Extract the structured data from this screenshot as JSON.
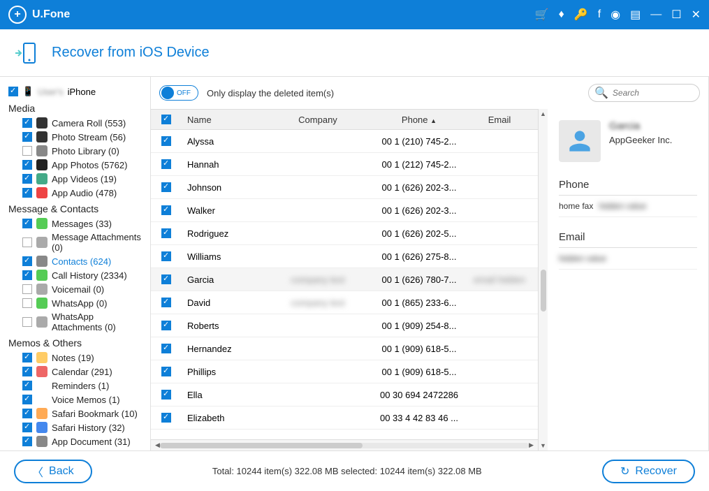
{
  "app_name": "U.Fone",
  "header": {
    "title": "Recover from iOS Device"
  },
  "sidebar": {
    "device": "iPhone",
    "sections": [
      {
        "title": "Media",
        "items": [
          {
            "label": "Camera Roll (553)",
            "checked": true,
            "iconBg": "#333"
          },
          {
            "label": "Photo Stream (56)",
            "checked": true,
            "iconBg": "#333"
          },
          {
            "label": "Photo Library (0)",
            "checked": false,
            "iconBg": "#888"
          },
          {
            "label": "App Photos (5762)",
            "checked": true,
            "iconBg": "#222"
          },
          {
            "label": "App Videos (19)",
            "checked": true,
            "iconBg": "#4a8"
          },
          {
            "label": "App Audio (478)",
            "checked": true,
            "iconBg": "#e44"
          }
        ]
      },
      {
        "title": "Message & Contacts",
        "items": [
          {
            "label": "Messages (33)",
            "checked": true,
            "iconBg": "#5c5"
          },
          {
            "label": "Message Attachments (0)",
            "checked": false,
            "iconBg": "#aaa"
          },
          {
            "label": "Contacts (624)",
            "checked": true,
            "iconBg": "#888",
            "active": true
          },
          {
            "label": "Call History (2334)",
            "checked": true,
            "iconBg": "#5c5"
          },
          {
            "label": "Voicemail (0)",
            "checked": false,
            "iconBg": "#aaa"
          },
          {
            "label": "WhatsApp (0)",
            "checked": false,
            "iconBg": "#5c5"
          },
          {
            "label": "WhatsApp Attachments (0)",
            "checked": false,
            "iconBg": "#aaa"
          }
        ]
      },
      {
        "title": "Memos & Others",
        "items": [
          {
            "label": "Notes (19)",
            "checked": true,
            "iconBg": "#fc6"
          },
          {
            "label": "Calendar (291)",
            "checked": true,
            "iconBg": "#e66"
          },
          {
            "label": "Reminders (1)",
            "checked": true,
            "iconBg": "#fff"
          },
          {
            "label": "Voice Memos (1)",
            "checked": true,
            "iconBg": "#fff"
          },
          {
            "label": "Safari Bookmark (10)",
            "checked": true,
            "iconBg": "#fa5"
          },
          {
            "label": "Safari History (32)",
            "checked": true,
            "iconBg": "#48e"
          },
          {
            "label": "App Document (31)",
            "checked": true,
            "iconBg": "#888"
          }
        ]
      }
    ]
  },
  "toolbar": {
    "toggle_state": "OFF",
    "toggle_text": "Only display the deleted item(s)",
    "search_placeholder": "Search"
  },
  "table": {
    "headers": {
      "name": "Name",
      "company": "Company",
      "phone": "Phone",
      "email": "Email"
    },
    "rows": [
      {
        "name": "Alyssa",
        "company": "",
        "phone": "00 1 (210) 745-2...",
        "email": ""
      },
      {
        "name": "Hannah",
        "company": "",
        "phone": "00 1 (212) 745-2...",
        "email": ""
      },
      {
        "name": "Johnson",
        "company": "",
        "phone": "00 1 (626) 202-3...",
        "email": ""
      },
      {
        "name": "Walker",
        "company": "",
        "phone": "00 1 (626) 202-3...",
        "email": ""
      },
      {
        "name": "Rodriguez",
        "company": "",
        "phone": "00 1 (626) 202-5...",
        "email": ""
      },
      {
        "name": "Williams",
        "company": "",
        "phone": "00 1 (626) 275-8...",
        "email": ""
      },
      {
        "name": "Garcia",
        "company": "blurred",
        "phone": "00 1 (626) 780-7...",
        "email": "blurred",
        "selected": true
      },
      {
        "name": "David",
        "company": "blurred",
        "phone": "00 1 (865) 233-6...",
        "email": ""
      },
      {
        "name": "Roberts",
        "company": "",
        "phone": "00 1 (909) 254-8...",
        "email": ""
      },
      {
        "name": "Hernandez",
        "company": "",
        "phone": "00 1 (909) 618-5...",
        "email": ""
      },
      {
        "name": "Phillips",
        "company": "",
        "phone": "00 1 (909) 618-5...",
        "email": ""
      },
      {
        "name": "Ella",
        "company": "",
        "phone": "00 30 694 2472286",
        "email": ""
      },
      {
        "name": "Elizabeth",
        "company": "",
        "phone": "00 33 4 42 83 46 ...",
        "email": ""
      }
    ]
  },
  "detail": {
    "name": "Garcia",
    "company": "AppGeeker Inc.",
    "phone_label": "Phone",
    "phone_key": "home fax",
    "phone_val": "hidden value",
    "email_label": "Email",
    "email_val": "hidden value"
  },
  "footer": {
    "back": "Back",
    "status": "Total: 10244 item(s) 322.08 MB    selected: 10244 item(s) 322.08 MB",
    "recover": "Recover"
  }
}
